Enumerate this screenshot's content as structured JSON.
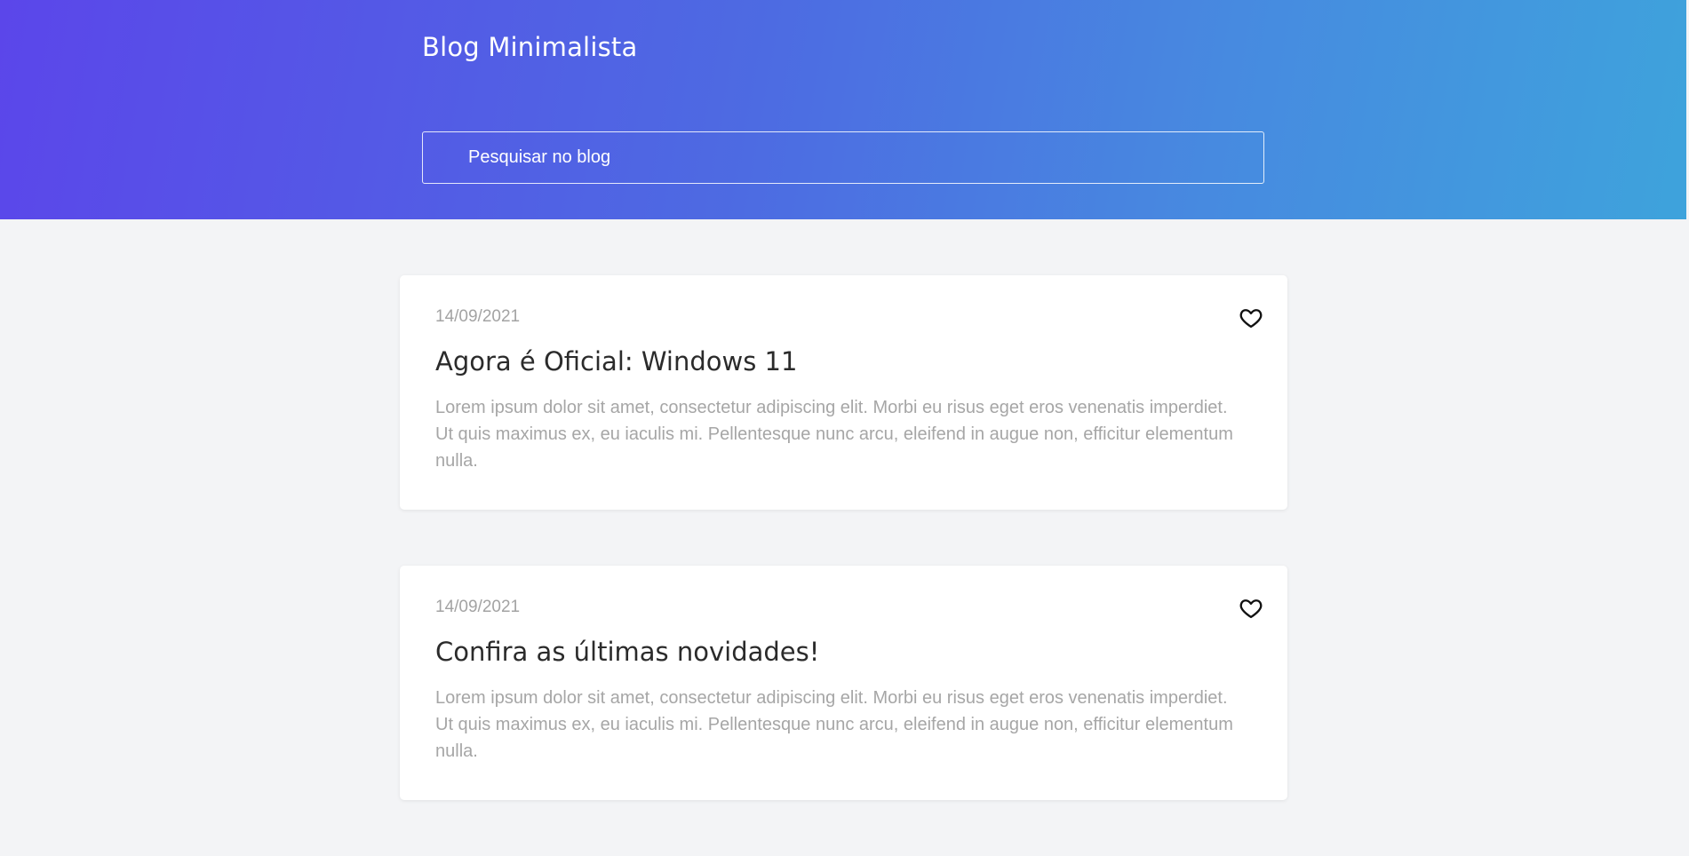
{
  "header": {
    "brand": "Blog Minimalista",
    "search_placeholder": "Pesquisar no blog",
    "gradient": [
      "#5b46ea",
      "#3ea3dc"
    ]
  },
  "posts": [
    {
      "date": "14/09/2021",
      "title": "Agora é Oficial: Windows 11",
      "excerpt": "Lorem ipsum dolor sit amet, consectetur adipiscing elit. Morbi eu risus eget eros venenatis imperdiet. Ut quis maximus ex, eu iaculis mi. Pellentesque nunc arcu, eleifend in augue non, efficitur elementum nulla.",
      "icon": "heart-outline-icon"
    },
    {
      "date": "14/09/2021",
      "title": "Confira as últimas novidades!",
      "excerpt": "Lorem ipsum dolor sit amet, consectetur adipiscing elit. Morbi eu risus eget eros venenatis imperdiet. Ut quis maximus ex, eu iaculis mi. Pellentesque nunc arcu, eleifend in augue non, efficitur elementum nulla.",
      "icon": "heart-outline-icon"
    }
  ]
}
